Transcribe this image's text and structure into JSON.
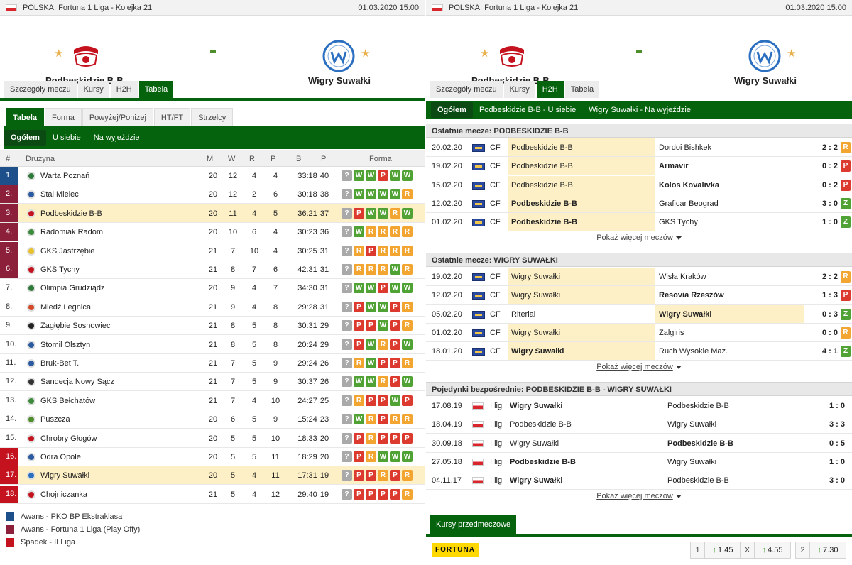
{
  "header": {
    "league": "POLSKA: Fortuna 1 Liga - Kolejka 21",
    "datetime": "01.03.2020 15:00"
  },
  "home_team": "Podbeskidzie B-B",
  "away_team": "Wigry Suwałki",
  "main_tabs": [
    "Szczegóły meczu",
    "Kursy",
    "H2H",
    "Tabela"
  ],
  "table_tabs": [
    "Tabela",
    "Forma",
    "Powyżej/Poniżej",
    "HT/FT",
    "Strzelcy"
  ],
  "table_subtabs": [
    "Ogółem",
    "U siebie",
    "Na wyjeździe"
  ],
  "table_headers": {
    "rank": "#",
    "team": "Drużyna",
    "m": "M",
    "w": "W",
    "r": "R",
    "p": "P",
    "b": "B",
    "pts": "P",
    "form": "Forma"
  },
  "standings": [
    {
      "rank": "1.",
      "team": "Warta Poznań",
      "m": "20",
      "w": "12",
      "r": "4",
      "p": "4",
      "b": "33:18",
      "pts": "40",
      "form": [
        "?",
        "W",
        "W",
        "P",
        "W",
        "W"
      ]
    },
    {
      "rank": "2.",
      "team": "Stal Mielec",
      "m": "20",
      "w": "12",
      "r": "2",
      "p": "6",
      "b": "30:18",
      "pts": "38",
      "form": [
        "?",
        "W",
        "W",
        "W",
        "W",
        "R"
      ]
    },
    {
      "rank": "3.",
      "team": "Podbeskidzie B-B",
      "m": "20",
      "w": "11",
      "r": "4",
      "p": "5",
      "b": "36:21",
      "pts": "37",
      "form": [
        "?",
        "P",
        "W",
        "W",
        "R",
        "W"
      ]
    },
    {
      "rank": "4.",
      "team": "Radomiak Radom",
      "m": "20",
      "w": "10",
      "r": "6",
      "p": "4",
      "b": "30:23",
      "pts": "36",
      "form": [
        "?",
        "W",
        "R",
        "R",
        "R",
        "R"
      ]
    },
    {
      "rank": "5.",
      "team": "GKS Jastrzębie",
      "m": "21",
      "w": "7",
      "r": "10",
      "p": "4",
      "b": "30:25",
      "pts": "31",
      "form": [
        "?",
        "R",
        "P",
        "R",
        "R",
        "R"
      ]
    },
    {
      "rank": "6.",
      "team": "GKS Tychy",
      "m": "21",
      "w": "8",
      "r": "7",
      "p": "6",
      "b": "42:31",
      "pts": "31",
      "form": [
        "?",
        "R",
        "R",
        "R",
        "W",
        "R"
      ]
    },
    {
      "rank": "7.",
      "team": "Olimpia Grudziądz",
      "m": "20",
      "w": "9",
      "r": "4",
      "p": "7",
      "b": "34:30",
      "pts": "31",
      "form": [
        "?",
        "W",
        "W",
        "P",
        "W",
        "W"
      ]
    },
    {
      "rank": "8.",
      "team": "Miedź Legnica",
      "m": "21",
      "w": "9",
      "r": "4",
      "p": "8",
      "b": "29:28",
      "pts": "31",
      "form": [
        "?",
        "P",
        "W",
        "W",
        "P",
        "R"
      ]
    },
    {
      "rank": "9.",
      "team": "Zagłębie Sosnowiec",
      "m": "21",
      "w": "8",
      "r": "5",
      "p": "8",
      "b": "30:31",
      "pts": "29",
      "form": [
        "?",
        "P",
        "P",
        "W",
        "P",
        "R"
      ]
    },
    {
      "rank": "10.",
      "team": "Stomil Olsztyn",
      "m": "21",
      "w": "8",
      "r": "5",
      "p": "8",
      "b": "20:24",
      "pts": "29",
      "form": [
        "?",
        "P",
        "W",
        "R",
        "P",
        "W"
      ]
    },
    {
      "rank": "11.",
      "team": "Bruk-Bet T.",
      "m": "21",
      "w": "7",
      "r": "5",
      "p": "9",
      "b": "29:24",
      "pts": "26",
      "form": [
        "?",
        "R",
        "W",
        "P",
        "P",
        "R"
      ]
    },
    {
      "rank": "12.",
      "team": "Sandecja Nowy Sącz",
      "m": "21",
      "w": "7",
      "r": "5",
      "p": "9",
      "b": "30:37",
      "pts": "26",
      "form": [
        "?",
        "W",
        "W",
        "R",
        "P",
        "W"
      ]
    },
    {
      "rank": "13.",
      "team": "GKS Bełchatów",
      "m": "21",
      "w": "7",
      "r": "4",
      "p": "10",
      "b": "24:27",
      "pts": "25",
      "form": [
        "?",
        "R",
        "P",
        "P",
        "W",
        "P"
      ]
    },
    {
      "rank": "14.",
      "team": "Puszcza",
      "m": "20",
      "w": "6",
      "r": "5",
      "p": "9",
      "b": "15:24",
      "pts": "23",
      "form": [
        "?",
        "W",
        "R",
        "P",
        "R",
        "R"
      ]
    },
    {
      "rank": "15.",
      "team": "Chrobry Głogów",
      "m": "20",
      "w": "5",
      "r": "5",
      "p": "10",
      "b": "18:33",
      "pts": "20",
      "form": [
        "?",
        "P",
        "R",
        "P",
        "P",
        "P"
      ]
    },
    {
      "rank": "16.",
      "team": "Odra Opole",
      "m": "20",
      "w": "5",
      "r": "5",
      "p": "11",
      "b": "18:29",
      "pts": "20",
      "form": [
        "?",
        "P",
        "R",
        "W",
        "W",
        "W"
      ]
    },
    {
      "rank": "17.",
      "team": "Wigry Suwałki",
      "m": "20",
      "w": "5",
      "r": "4",
      "p": "11",
      "b": "17:31",
      "pts": "19",
      "form": [
        "?",
        "P",
        "P",
        "R",
        "P",
        "R"
      ]
    },
    {
      "rank": "18.",
      "team": "Chojniczanka",
      "m": "21",
      "w": "5",
      "r": "4",
      "p": "12",
      "b": "29:40",
      "pts": "19",
      "form": [
        "?",
        "P",
        "P",
        "P",
        "P",
        "R"
      ]
    }
  ],
  "legend": [
    "Awans - PKO BP Ekstraklasa",
    "Awans - Fortuna 1 Liga (Play Offy)",
    "Spadek - II Liga"
  ],
  "colors": {
    "accent": "#05620d",
    "promotion": "#1d4f8a",
    "playoff": "#8c1f3a",
    "relegation": "#c4121f",
    "win": "#51a235",
    "loss": "#dc3a2e",
    "draw": "#f2a531",
    "highlight": "#fdf0c6"
  },
  "h2h_subtabs": [
    "Ogółem",
    "Podbeskidzie B-B - U siebie",
    "Wigry Suwałki - Na wyjeździe"
  ],
  "home_recent": {
    "title": "Ostatnie mecze: PODBESKIDZIE B-B",
    "rows": [
      {
        "date": "20.02.20",
        "comp": "CF",
        "home": "Podbeskidzie B-B",
        "away": "Dordoi Bishkek",
        "score": "2 : 2",
        "res": "R"
      },
      {
        "date": "19.02.20",
        "comp": "CF",
        "home": "Podbeskidzie B-B",
        "away": "Armavir",
        "score": "0 : 2",
        "res": "P"
      },
      {
        "date": "15.02.20",
        "comp": "CF",
        "home": "Podbeskidzie B-B",
        "away": "Kolos Kovalivka",
        "score": "0 : 2",
        "res": "P"
      },
      {
        "date": "12.02.20",
        "comp": "CF",
        "home": "Podbeskidzie B-B",
        "away": "Graficar Beograd",
        "score": "3 : 0",
        "res": "Z"
      },
      {
        "date": "01.02.20",
        "comp": "CF",
        "home": "Podbeskidzie B-B",
        "away": "GKS Tychy",
        "score": "1 : 0",
        "res": "Z"
      }
    ]
  },
  "away_recent": {
    "title": "Ostatnie mecze: WIGRY SUWAŁKI",
    "rows": [
      {
        "date": "19.02.20",
        "comp": "CF",
        "home": "Wigry Suwałki",
        "away": "Wisła Kraków",
        "score": "2 : 2",
        "res": "R"
      },
      {
        "date": "12.02.20",
        "comp": "CF",
        "home": "Wigry Suwałki",
        "away": "Resovia Rzeszów",
        "score": "1 : 3",
        "res": "P"
      },
      {
        "date": "05.02.20",
        "comp": "CF",
        "home": "Riteriai",
        "away": "Wigry Suwałki",
        "score": "0 : 3",
        "res": "Z"
      },
      {
        "date": "01.02.20",
        "comp": "CF",
        "home": "Wigry Suwałki",
        "away": "Zalgiris",
        "score": "0 : 0",
        "res": "R"
      },
      {
        "date": "18.01.20",
        "comp": "CF",
        "home": "Wigry Suwałki",
        "away": "Ruch Wysokie Maz.",
        "score": "4 : 1",
        "res": "Z"
      }
    ]
  },
  "head_to_head": {
    "title": "Pojedynki bezpośrednie: PODBESKIDZIE B-B - WIGRY SUWAŁKI",
    "rows": [
      {
        "date": "17.08.19",
        "comp": "I lig",
        "home": "Wigry Suwałki",
        "away": "Podbeskidzie B-B",
        "score": "1 : 0"
      },
      {
        "date": "18.04.19",
        "comp": "I lig",
        "home": "Podbeskidzie B-B",
        "away": "Wigry Suwałki",
        "score": "3 : 3"
      },
      {
        "date": "30.09.18",
        "comp": "I lig",
        "home": "Wigry Suwałki",
        "away": "Podbeskidzie B-B",
        "score": "0 : 5"
      },
      {
        "date": "27.05.18",
        "comp": "I lig",
        "home": "Podbeskidzie B-B",
        "away": "Wigry Suwałki",
        "score": "1 : 0"
      },
      {
        "date": "04.11.17",
        "comp": "I lig",
        "home": "Wigry Suwałki",
        "away": "Podbeskidzie B-B",
        "score": "3 : 0"
      }
    ]
  },
  "show_more": "Pokaż więcej meczów",
  "odds": {
    "tab": "Kursy przedmeczowe",
    "bookmaker": "FORTUNA",
    "labels": [
      "1",
      "X",
      "2"
    ],
    "values": [
      "1.45",
      "4.55",
      "7.30"
    ]
  }
}
